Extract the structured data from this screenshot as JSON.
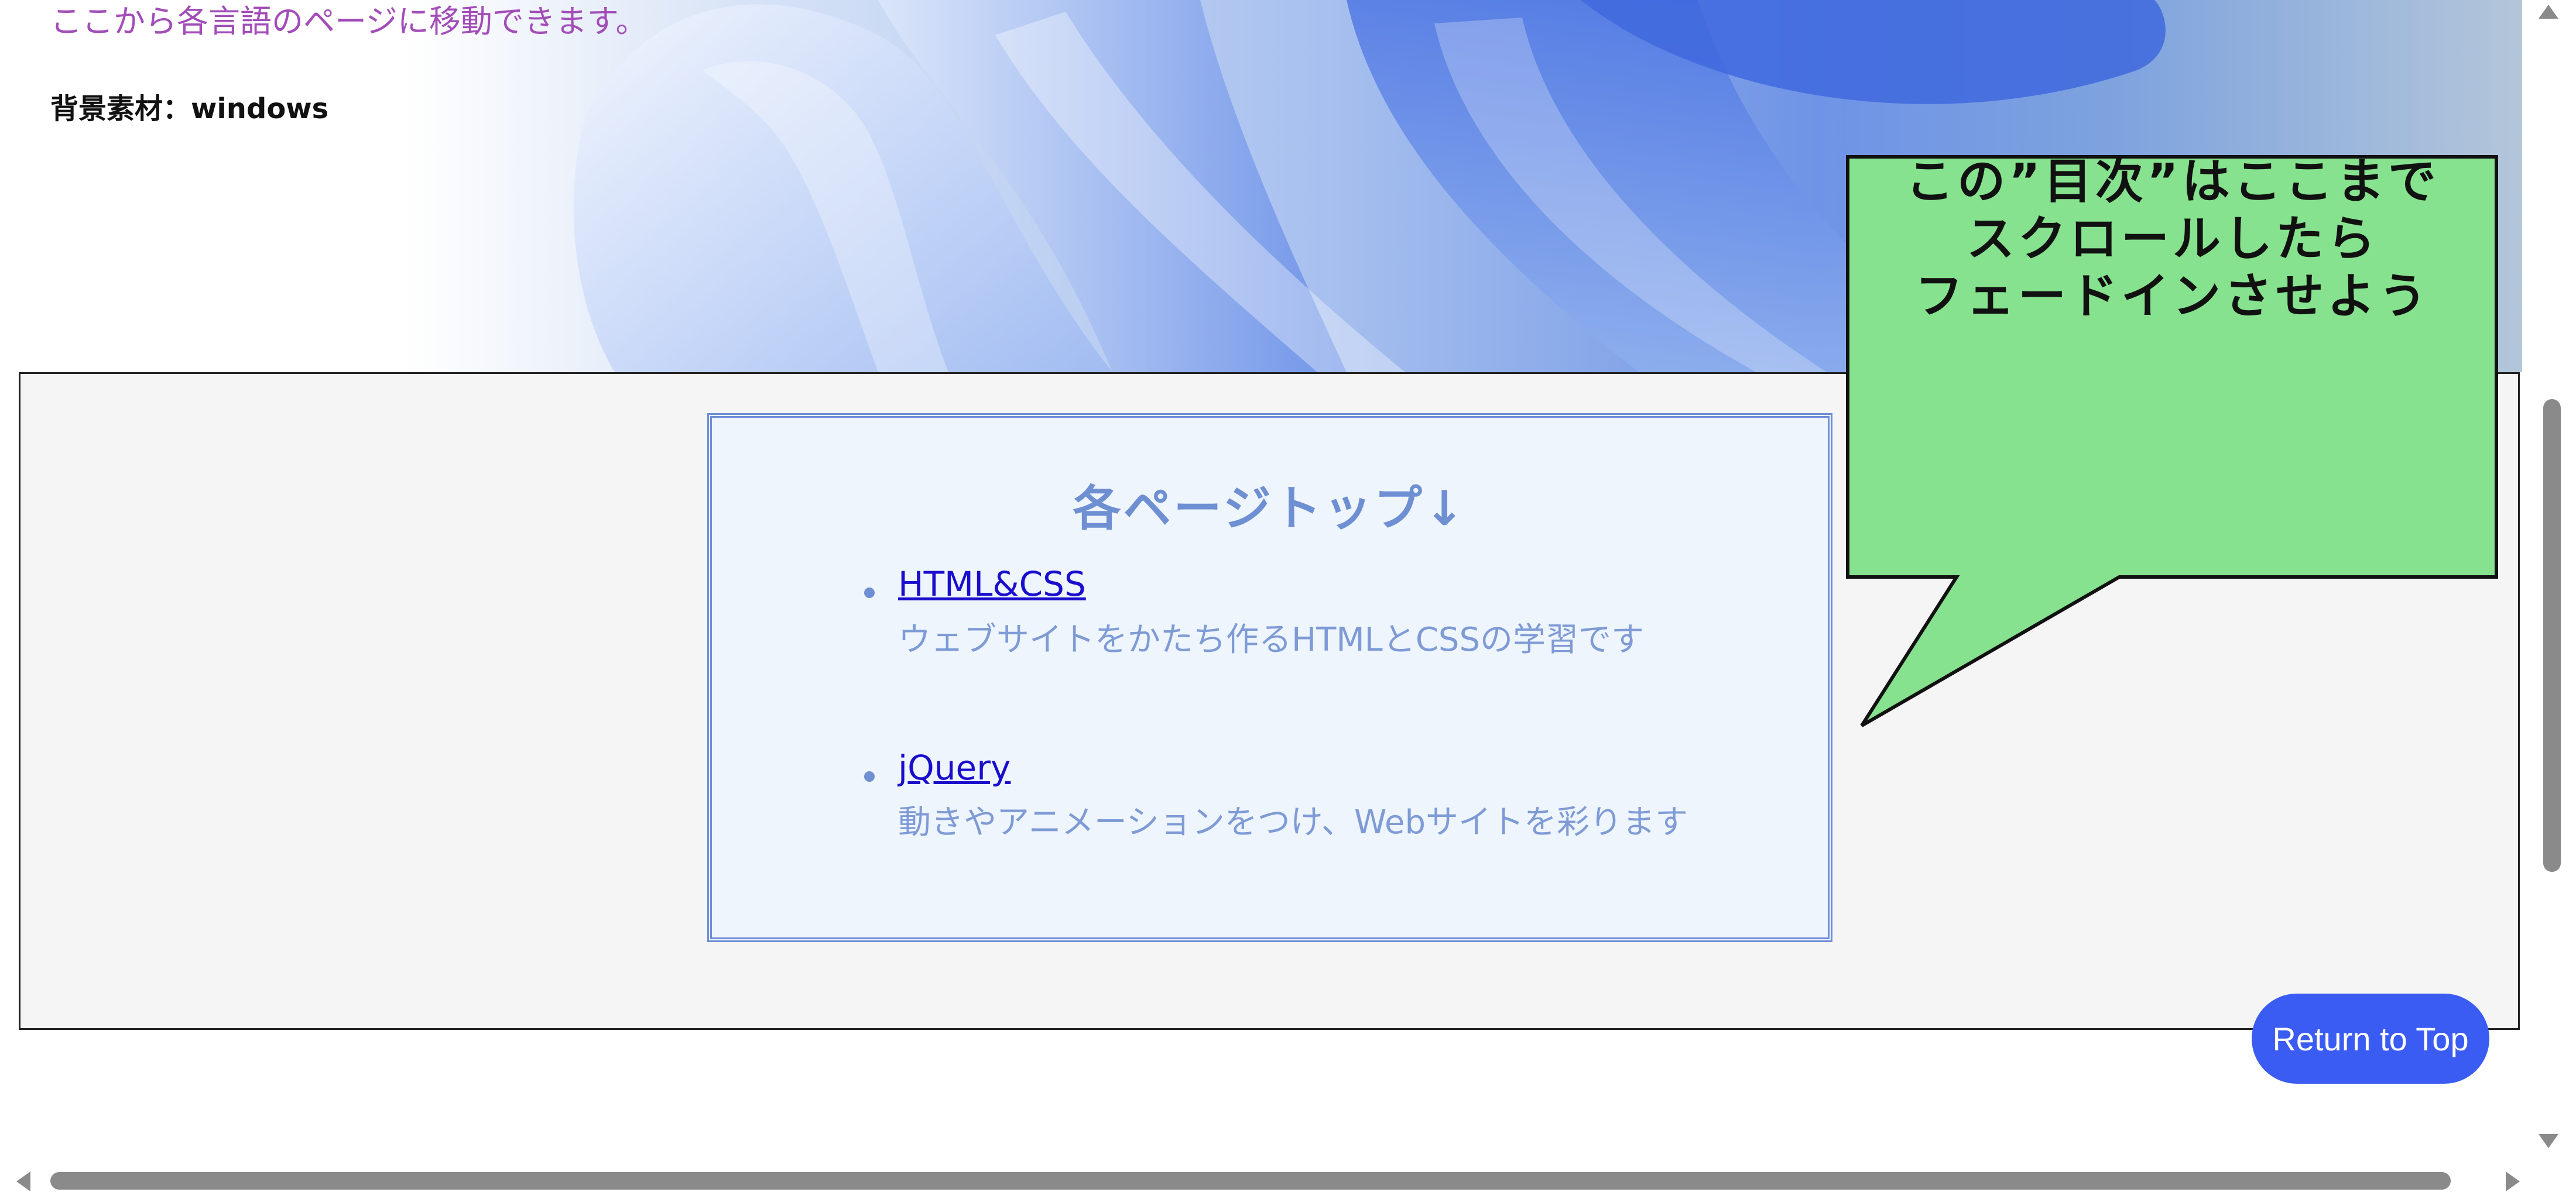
{
  "hero": {
    "subtitle": "ここから各言語のページに移動できます。",
    "credit": "背景素材：windows"
  },
  "toc": {
    "title": "各ページトップ↓",
    "items": [
      {
        "link": "HTML&CSS",
        "description": "ウェブサイトをかたち作るHTMLとCSSの学習です"
      },
      {
        "link": "jQuery",
        "description": "動きやアニメーションをつけ、Webサイトを彩ります"
      }
    ]
  },
  "callout": {
    "text": "この”目次”はここまで\nスクロールしたら\nフェードインさせよう"
  },
  "return_to_top": {
    "label": "Return to Top"
  },
  "colors": {
    "subtitle": "#a24db8",
    "toc_accent": "#6f8fd3",
    "link": "#1a0dcc",
    "callout_fill": "#86e28e",
    "button": "#3b5cf2"
  }
}
